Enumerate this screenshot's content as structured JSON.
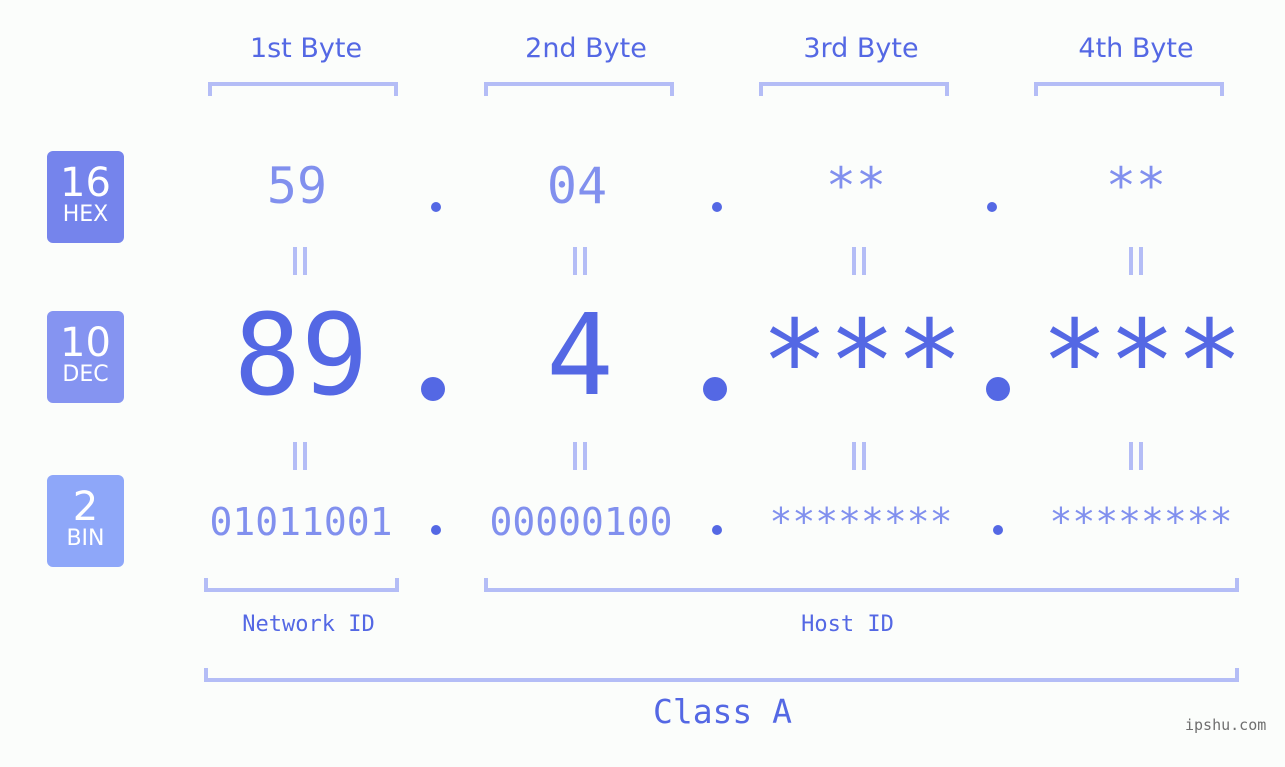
{
  "byte_headers": [
    "1st Byte",
    "2nd Byte",
    "3rd Byte",
    "4th Byte"
  ],
  "badges": {
    "hex": {
      "base": "16",
      "label": "HEX",
      "color": "#7584ec"
    },
    "dec": {
      "base": "10",
      "label": "DEC",
      "color": "#8594f1"
    },
    "bin": {
      "base": "2",
      "label": "BIN",
      "color": "#8ea7f9"
    }
  },
  "hex_values": [
    "59",
    "04",
    "**",
    "**"
  ],
  "dec_values": [
    "89",
    "4",
    "***",
    "***"
  ],
  "bin_values": [
    "01011001",
    "00000100",
    "********",
    "********"
  ],
  "separator": ".",
  "equals_symbol": "=",
  "network_id_label": "Network ID",
  "host_id_label": "Host ID",
  "class_label": "Class A",
  "watermark": "ipshu.com",
  "colors": {
    "primary": "#5468e4",
    "secondary": "#8190ee",
    "bracket": "#b4bdf6",
    "background": "#fbfdfb"
  }
}
